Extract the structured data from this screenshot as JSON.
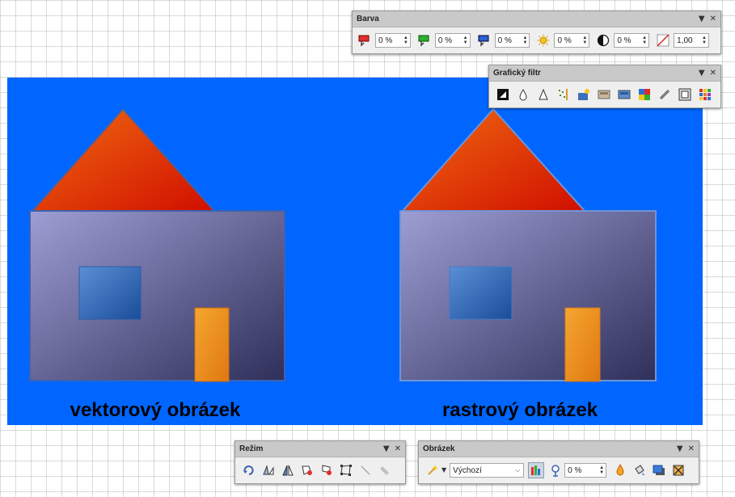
{
  "drawing": {
    "background_color": "#0066ff",
    "left_label": "vektorový obrázek",
    "right_label": "rastrový obrázek",
    "roof_colors": [
      "#f06a10",
      "#d00f00"
    ],
    "wall_colors": [
      "#9e9ed4",
      "#2f2f5a"
    ],
    "window_colors": [
      "#5a8fd6",
      "#1a4d9a"
    ],
    "door_colors": [
      "#f5a630",
      "#e07810"
    ]
  },
  "toolbars": {
    "color": {
      "title": "Barva",
      "fields": [
        {
          "icon": "red-channel-icon",
          "value": "0 %"
        },
        {
          "icon": "green-channel-icon",
          "value": "0 %"
        },
        {
          "icon": "blue-channel-icon",
          "value": "0 %"
        },
        {
          "icon": "brightness-icon",
          "value": "0 %"
        },
        {
          "icon": "contrast-icon",
          "value": "0 %"
        },
        {
          "icon": "gamma-icon",
          "value": "1,00"
        }
      ]
    },
    "filter": {
      "title": "Grafický filtr"
    },
    "mode": {
      "title": "Režim"
    },
    "image": {
      "title": "Obrázek",
      "graphics_mode": "Výchozí",
      "transparency": "0 %"
    }
  }
}
